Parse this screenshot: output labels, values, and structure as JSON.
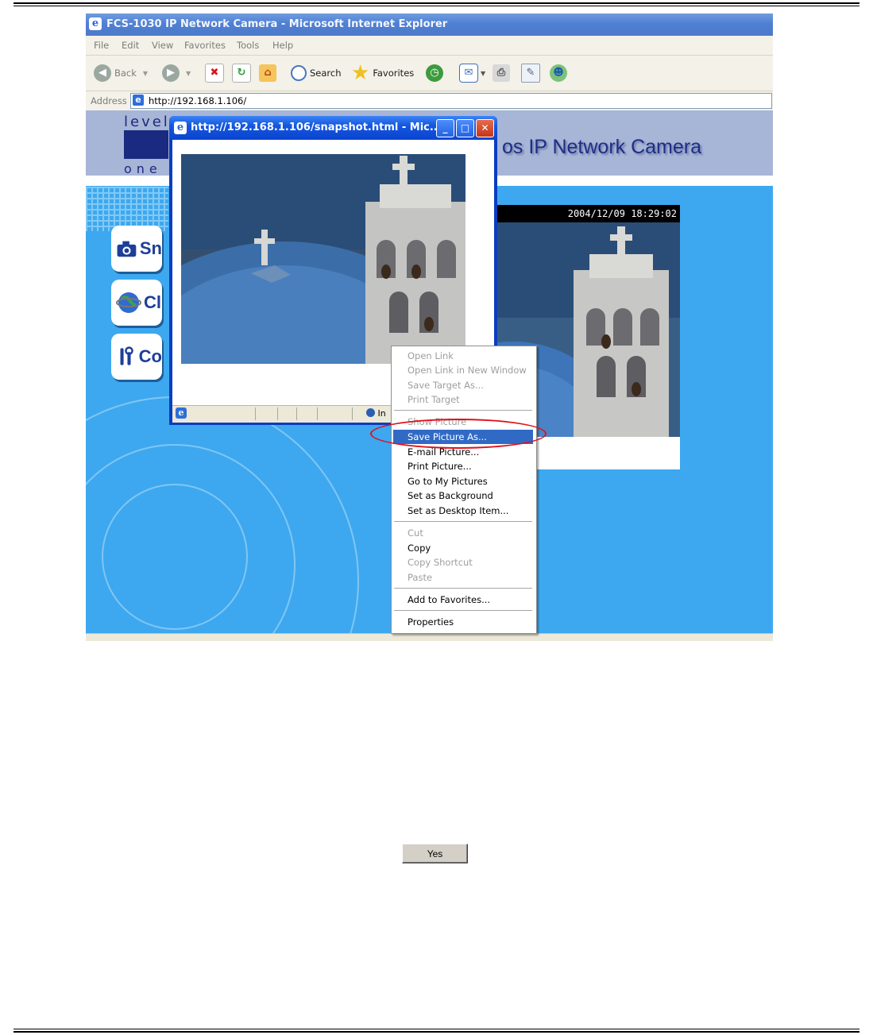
{
  "window": {
    "title": "FCS-1030 IP Network Camera - Microsoft Internet Explorer",
    "menu": [
      "File",
      "Edit",
      "View",
      "Favorites",
      "Tools",
      "Help"
    ],
    "toolbar": {
      "back": "Back",
      "search": "Search",
      "favorites": "Favorites"
    },
    "address_label": "Address",
    "address": "http://192.168.1.106/"
  },
  "page": {
    "camera_title": "os IP Network Camera",
    "logo_top": "level",
    "logo_bottom": "one",
    "timestamp": "2004/12/09 18:29:02",
    "nav_letters": [
      "Sn",
      "Cl",
      "Co"
    ]
  },
  "popup": {
    "title": "http://192.168.1.106/snapshot.html - Mic...",
    "status_text": "In"
  },
  "context_menu": {
    "items": [
      {
        "label": "Open Link",
        "disabled": true
      },
      {
        "label": "Open Link in New Window",
        "disabled": true
      },
      {
        "label": "Save Target As...",
        "disabled": true
      },
      {
        "label": "Print Target",
        "disabled": true
      },
      {
        "label": "Show Picture",
        "disabled": true
      },
      {
        "label": "Save Picture As...",
        "highlighted": true
      },
      {
        "label": "E-mail Picture..."
      },
      {
        "label": "Print Picture..."
      },
      {
        "label": "Go to My Pictures"
      },
      {
        "label": "Set as Background"
      },
      {
        "label": "Set as Desktop Item..."
      },
      {
        "label": "Cut",
        "disabled": true
      },
      {
        "label": "Copy"
      },
      {
        "label": "Copy Shortcut",
        "disabled": true
      },
      {
        "label": "Paste",
        "disabled": true
      },
      {
        "label": "Add to Favorites..."
      },
      {
        "label": "Properties"
      }
    ]
  },
  "dialog": {
    "yes_label": "Yes"
  },
  "colors": {
    "accent": "#316ac5",
    "page_bg": "#3da8ef",
    "highlight_oval": "#e0101a"
  }
}
